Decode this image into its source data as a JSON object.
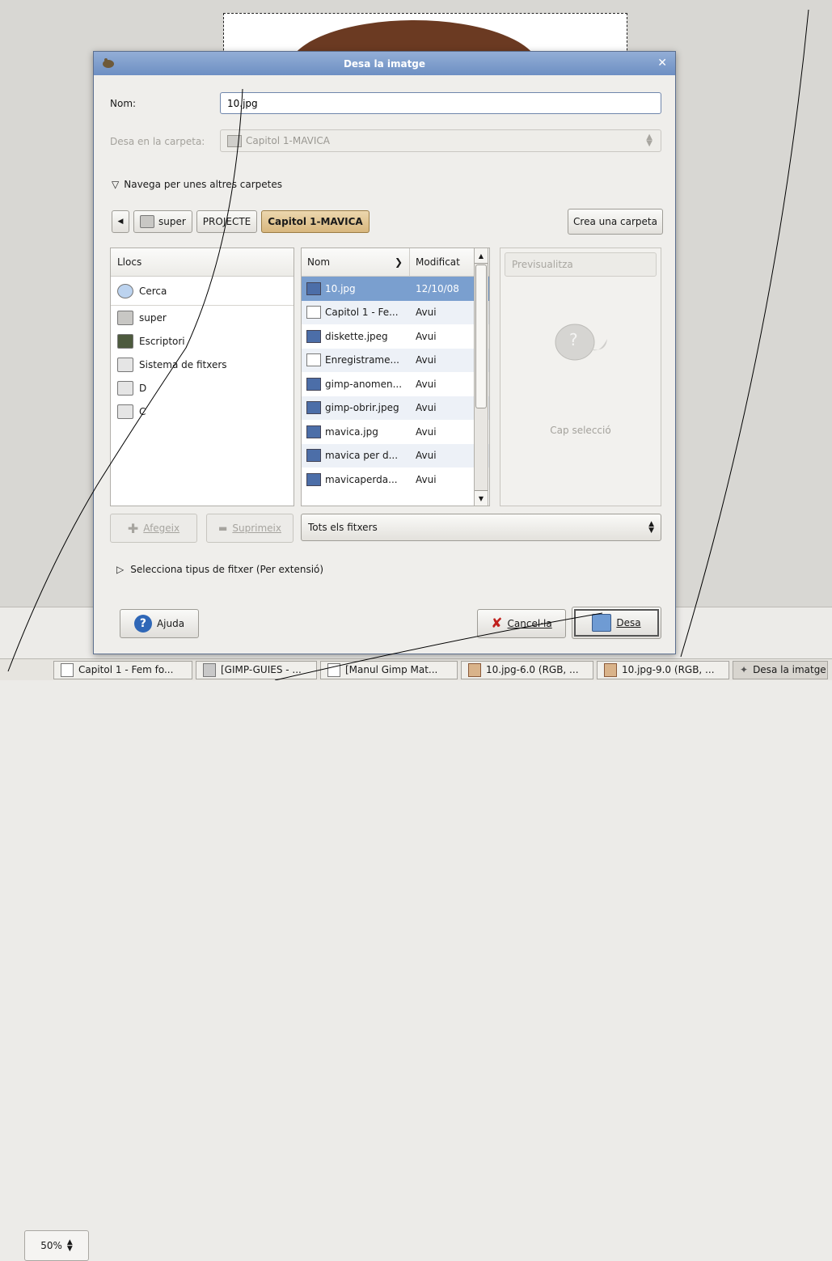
{
  "dialog": {
    "title": "Desa la imatge",
    "name_label": "Nom:",
    "name_value": "10.jpg",
    "folder_label": "Desa en la carpeta:",
    "folder_value": "Capitol 1-MAVICA",
    "browse_label": "Navega per unes altres carpetes",
    "breadcrumbs": [
      "super",
      "PROJECTE",
      "Capitol 1-MAVICA"
    ],
    "create_folder_label": "Crea una carpeta",
    "places": {
      "header": "Llocs",
      "items": [
        "Cerca",
        "super",
        "Escriptori",
        "Sistema de fitxers",
        "D",
        "C"
      ],
      "icons": [
        "search-icon",
        "home-folder-icon",
        "desktop-icon",
        "drive-icon",
        "drive-icon",
        "drive-icon"
      ]
    },
    "files": {
      "col_name": "Nom",
      "col_modified": "Modificat",
      "rows": [
        {
          "name": "10.jpg",
          "modified": "12/10/08",
          "icon": "image-icon",
          "selected": true
        },
        {
          "name": "Capitol 1 - Fe...",
          "modified": "Avui",
          "icon": "document-icon",
          "selected": false
        },
        {
          "name": "diskette.jpeg",
          "modified": "Avui",
          "icon": "image-icon",
          "selected": false
        },
        {
          "name": "Enregistrame...",
          "modified": "Avui",
          "icon": "document-icon",
          "selected": false
        },
        {
          "name": "gimp-anomen...",
          "modified": "Avui",
          "icon": "image-icon",
          "selected": false
        },
        {
          "name": "gimp-obrir.jpeg",
          "modified": "Avui",
          "icon": "image-icon",
          "selected": false
        },
        {
          "name": "mavica.jpg",
          "modified": "Avui",
          "icon": "image-icon",
          "selected": false
        },
        {
          "name": "mavica per d...",
          "modified": "Avui",
          "icon": "image-icon",
          "selected": false
        },
        {
          "name": "mavicaperda...",
          "modified": "Avui",
          "icon": "image-icon",
          "selected": false
        }
      ]
    },
    "preview_label": "Previsualitza",
    "no_selection": "Cap selecció",
    "add_label": "Afegeix",
    "remove_label": "Suprimeix",
    "filter_value": "Tots els fitxers",
    "filetype_label": "Selecciona tipus de fitxer (Per extensió)",
    "help_label": "Ajuda",
    "cancel_label": "Cancel·la",
    "save_label": "Desa"
  },
  "status": {
    "zoom": "50%"
  },
  "taskbar": [
    {
      "label": "Capitol 1 - Fem fo...",
      "icon": "document-icon",
      "active": false
    },
    {
      "label": "[GIMP-GUIES - ...",
      "icon": "folder-icon",
      "active": false
    },
    {
      "label": "[Manul Gimp Mat...",
      "icon": "document-icon",
      "active": false
    },
    {
      "label": "10.jpg-6.0 (RGB, ...",
      "icon": "image-icon",
      "active": false
    },
    {
      "label": "10.jpg-9.0 (RGB, ...",
      "icon": "image-icon",
      "active": false
    },
    {
      "label": "Desa la imatge",
      "icon": "gimp-icon",
      "active": true
    }
  ],
  "colors": {
    "titlebar": "#7b9bcc",
    "selection": "#7a9fcf",
    "current_crumb": "#e0c28e"
  }
}
